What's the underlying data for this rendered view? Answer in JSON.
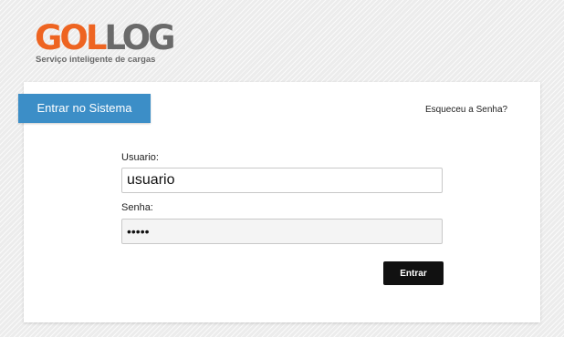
{
  "brand": {
    "logo_part_1": "GOL",
    "logo_part_2": "LOG",
    "tagline": "Serviço inteligente de cargas"
  },
  "login": {
    "tab_label": "Entrar no Sistema",
    "forgot_link": "Esqueceu a Senha?",
    "username_label": "Usuario:",
    "username_value": "usuario",
    "password_label": "Senha:",
    "password_value": "•••••",
    "submit_label": "Entrar"
  },
  "colors": {
    "brand_orange": "#ee6421",
    "brand_gray": "#6a6a6a",
    "tab_blue": "#3c8ec7",
    "button_black": "#111111"
  }
}
